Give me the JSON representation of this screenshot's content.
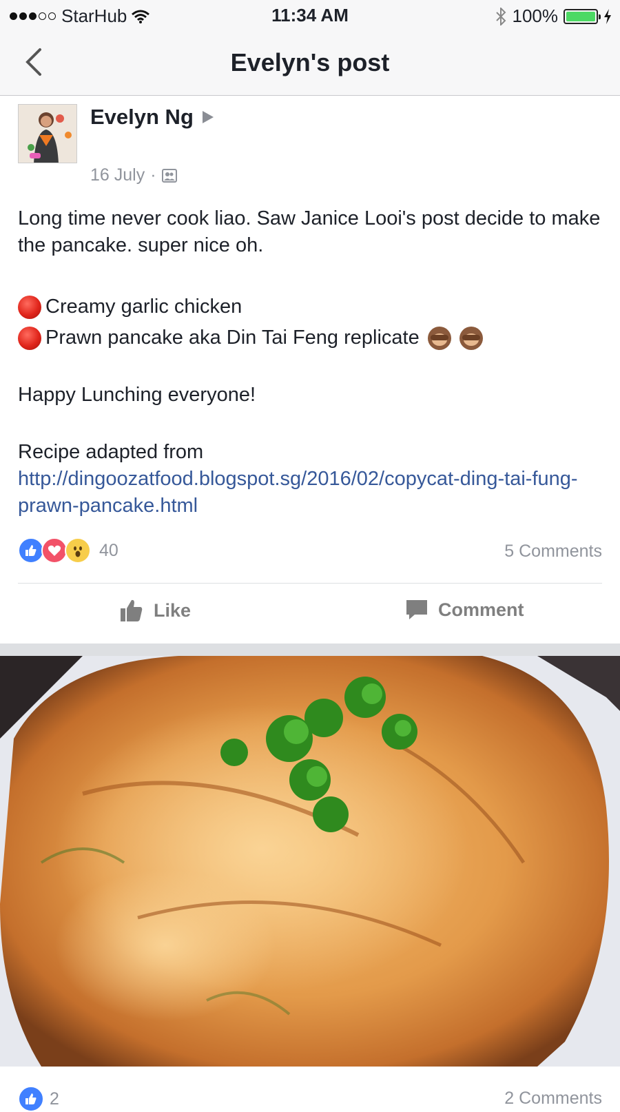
{
  "status_bar": {
    "carrier": "StarHub",
    "time": "11:34 AM",
    "battery": "100%",
    "battery_level": 1.0,
    "signal_bars_filled": 3,
    "signal_bars_total": 5
  },
  "nav": {
    "title": "Evelyn's post",
    "back_icon": "chevron-left-icon"
  },
  "post": {
    "author": "Evelyn Ng",
    "date": "16 July",
    "date_separator": "·",
    "audience_icon": "friends-icon",
    "lines": {
      "intro": "Long time never cook liao. Saw Janice Looi's post decide to make the pancake. super nice oh.",
      "bullet1": "Creamy garlic chicken",
      "bullet2": "Prawn pancake aka Din Tai Feng replicate",
      "closing": "Happy Lunching everyone!",
      "recipe_label": "Recipe adapted from",
      "recipe_link": "http://dingoozatfood.blogspot.sg/2016/02/copycat-ding-tai-fung-prawn-pancake.html"
    },
    "reaction_count": "40",
    "comments_count": "5 Comments",
    "actions": {
      "like": "Like",
      "comment": "Comment"
    }
  },
  "photo_item": {
    "reaction_count": "2",
    "comments_count": "2 Comments"
  },
  "colors": {
    "link": "#365899",
    "like_blue": "#4080ff",
    "love_red": "#f25268",
    "wow_yellow": "#f7cd4a",
    "muted": "#90949c"
  }
}
